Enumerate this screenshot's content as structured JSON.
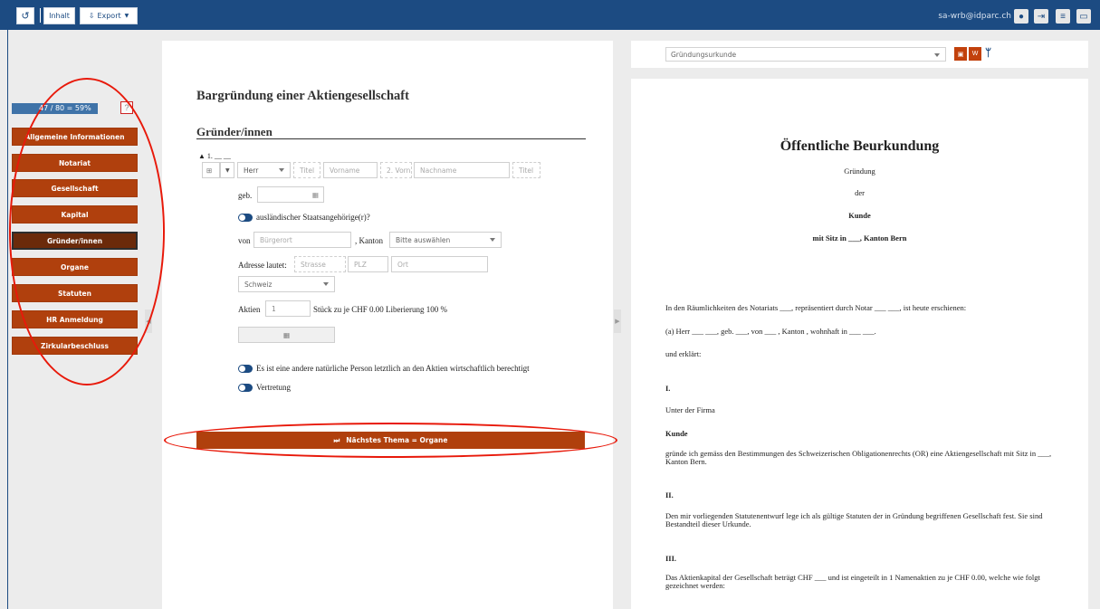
{
  "toolbar": {
    "undo_icon": "undo-icon",
    "inhalt_label": "Inhalt",
    "export_label": "Export",
    "user": "sa-wrb@idparc.ch"
  },
  "sidebar": {
    "progress": "47 / 80 = 59%",
    "progress_value": 0.59,
    "items": [
      {
        "label": "Allgemeine Informationen"
      },
      {
        "label": "Notariat"
      },
      {
        "label": "Gesellschaft"
      },
      {
        "label": "Kapital"
      },
      {
        "label": "Gründer/innen"
      },
      {
        "label": "Organe"
      },
      {
        "label": "Statuten"
      },
      {
        "label": "HR Anmeldung"
      },
      {
        "label": "Zirkularbeschluss"
      }
    ],
    "active": "Gründer/innen"
  },
  "form": {
    "title": "Bargründung einer Aktiengesellschaft",
    "section": "Gründer/innen",
    "entry_label": "1. __ __",
    "salutation": "Herr",
    "ph_titel": "Titel",
    "ph_vorname": "Vorname",
    "ph_2vorn": "2. Vorn",
    "ph_nachname": "Nachname",
    "ph_titel2": "Titel",
    "geb_label": "geb.",
    "foreign_label": "ausländischer Staatsangehörige(r)?",
    "von_label": "von",
    "ph_buergerort": "Bürgerort",
    "kanton_label": ", Kanton",
    "kanton_select": "Bitte auswählen",
    "adresse_label": "Adresse lautet:",
    "ph_strasse": "Strasse",
    "ph_plz": "PLZ",
    "ph_ort": "Ort",
    "country": "Schweiz",
    "aktien_label": "Aktien",
    "aktien_value": "1",
    "aktien_text": "Stück zu je CHF 0.00 Liberierung 100 %",
    "beneficial_label": "Es ist eine andere natürliche Person letztlich an den Aktien wirtschaftlich berechtigt",
    "vertretung_label": "Vertretung",
    "next_label": "Nächstes Thema = Organe"
  },
  "document": {
    "selector": "Gründungsurkunde",
    "heading": "Öffentliche Beurkundung",
    "line1": "Gründung",
    "line2": "der",
    "company": "Kunde",
    "seat": "mit Sitz in ___, Kanton Bern",
    "p1": "In den Räumlichkeiten des Notariats ___, repräsentiert durch Notar ___ ___, ist heute erschienen:",
    "p2": "(a)    Herr ___ ___, geb. ___, von ___ , Kanton , wohnhaft in ___ ___.",
    "p3": "und erklärt:",
    "s1": "I.",
    "p4": "Unter der Firma",
    "p5": "Kunde",
    "p6": "gründe ich gemäss den Bestimmungen des Schweizerischen Obligationenrechts (OR) eine Aktiengesellschaft mit Sitz in ___, Kanton Bern.",
    "s2": "II.",
    "p7": "Den mir vorliegenden Statutenentwurf lege ich als gültige Statuten der in Gründung begriffenen Gesellschaft fest. Sie sind Bestandteil dieser Urkunde.",
    "s3": "III.",
    "p8": "Das Aktienkapital der Gesellschaft beträgt CHF ___ und ist eingeteilt in 1 Namenaktien zu je CHF 0.00, welche wie folgt gezeichnet werden:"
  },
  "colors": {
    "topbar": "#1c4b82",
    "nav": "#b0400d",
    "nav_active": "#6b2a0a",
    "highlight": "#e8190a"
  }
}
